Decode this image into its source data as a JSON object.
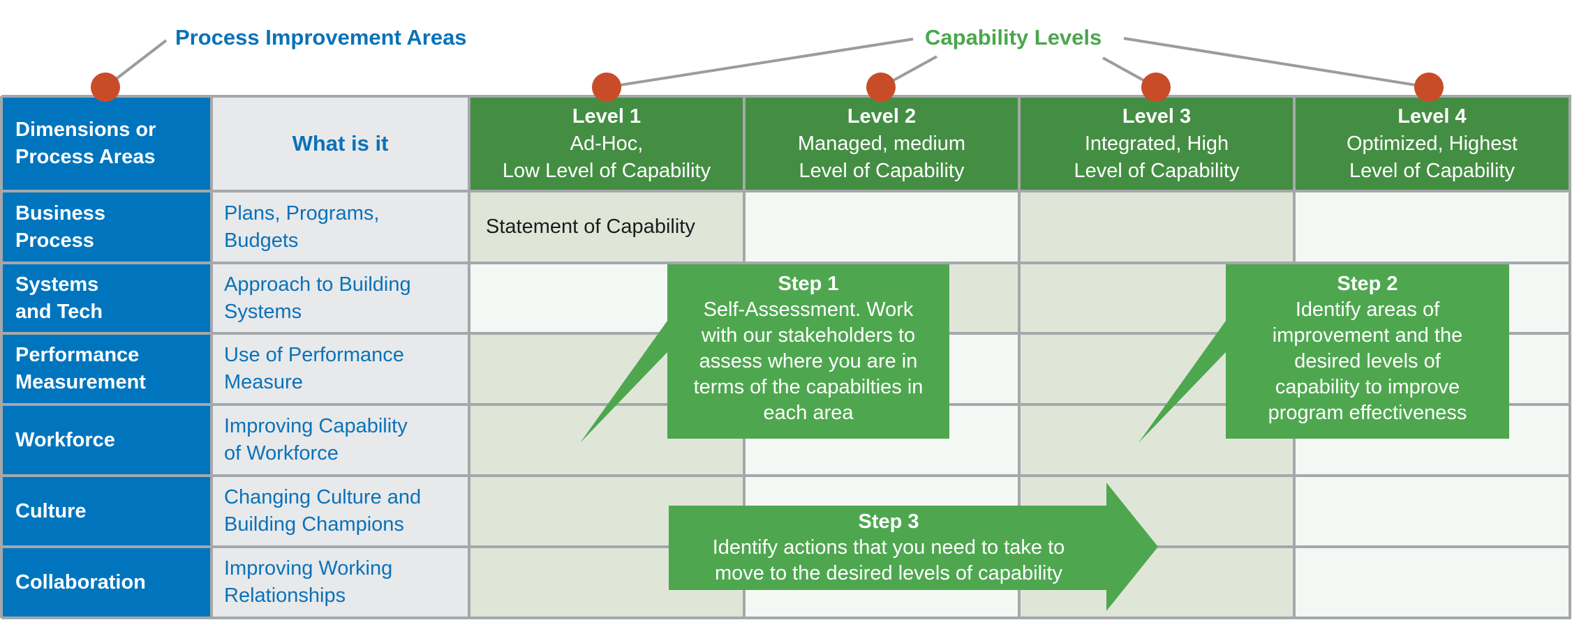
{
  "annotations": {
    "process_areas_label": "Process Improvement Areas",
    "capability_levels_label": "Capability Levels"
  },
  "colors": {
    "dimension_blue": "#0075be",
    "what_text_blue": "#0a72b8",
    "level_header_green": "#448e43",
    "callout_green": "#4ea74f",
    "label_green": "#4ca64c",
    "marker_orange": "#c94c28",
    "cell_shaded": "#dfe6d8",
    "cell_light": "#f4f8f4",
    "grid_gray": "#a5a8aa"
  },
  "header": {
    "dimensions": "Dimensions or Process Areas",
    "dimensions_lines": [
      "Dimensions or",
      "Process Areas"
    ],
    "what": "What is it",
    "levels": [
      {
        "title": "Level 1",
        "line1": "Ad-Hoc,",
        "line2": "Low Level of Capability"
      },
      {
        "title": "Level 2",
        "line1": "Managed, medium",
        "line2": "Level of Capability"
      },
      {
        "title": "Level 3",
        "line1": "Integrated, High",
        "line2": "Level of Capability"
      },
      {
        "title": "Level 4",
        "line1": "Optimized, Highest",
        "line2": "Level of Capability"
      }
    ]
  },
  "rows": [
    {
      "area": [
        "Business",
        "Process"
      ],
      "what": [
        "Plans, Programs,",
        "Budgets"
      ],
      "shading": [
        "shaded",
        "light",
        "shaded",
        "light"
      ],
      "cells": [
        "Statement of Capability",
        "",
        "",
        ""
      ]
    },
    {
      "area": [
        "Systems",
        "and Tech"
      ],
      "what": [
        "Approach to Building",
        "Systems"
      ],
      "shading": [
        "light",
        "shaded",
        "shaded",
        "light"
      ],
      "cells": [
        "",
        "",
        "",
        ""
      ]
    },
    {
      "area": [
        "Performance",
        "Measurement"
      ],
      "what": [
        "Use of Performance",
        "Measure"
      ],
      "shading": [
        "shaded",
        "light",
        "shaded",
        "light"
      ],
      "cells": [
        "",
        "",
        "",
        ""
      ]
    },
    {
      "area": [
        "Workforce"
      ],
      "what": [
        "Improving Capability",
        "of Workforce"
      ],
      "shading": [
        "shaded",
        "light",
        "shaded",
        "light"
      ],
      "cells": [
        "",
        "",
        "",
        ""
      ]
    },
    {
      "area": [
        "Culture"
      ],
      "what": [
        "Changing Culture and",
        "Building Champions"
      ],
      "shading": [
        "shaded",
        "light",
        "shaded",
        "light"
      ],
      "cells": [
        "",
        "",
        "",
        ""
      ]
    },
    {
      "area": [
        "Collaboration"
      ],
      "what": [
        "Improving Working",
        "Relationships"
      ],
      "shading": [
        "shaded",
        "light",
        "shaded",
        "light"
      ],
      "cells": [
        "",
        "",
        "",
        ""
      ]
    }
  ],
  "steps": [
    {
      "title": "Step 1",
      "lines": [
        "Self-Assessment. Work",
        "with our stakeholders to",
        "assess where you are in",
        "terms of the capabilties in",
        "each area"
      ]
    },
    {
      "title": "Step 2",
      "lines": [
        "Identify areas of",
        "improvement and the",
        "desired levels of",
        "capability to improve",
        "program effectiveness"
      ]
    },
    {
      "title": "Step 3",
      "lines": [
        "Identify actions that you need to take to",
        "move to the desired levels of capability"
      ]
    }
  ]
}
